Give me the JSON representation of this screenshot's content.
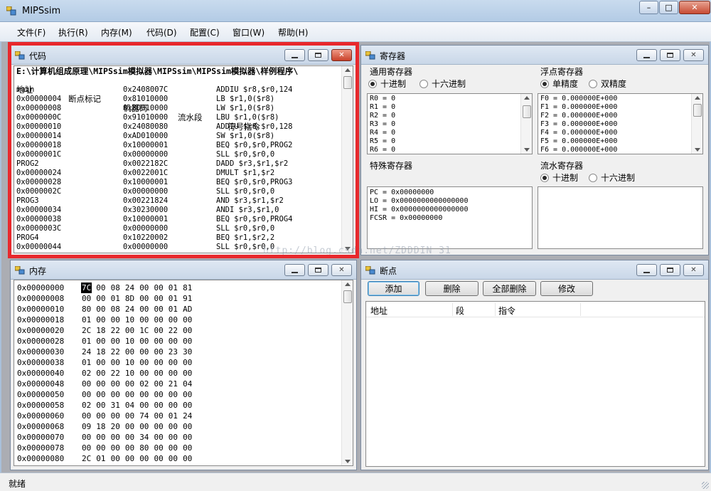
{
  "app": {
    "title": "MIPSsim"
  },
  "window_controls": {
    "minimize_glyph": "–",
    "maximize_glyph": "□",
    "close_glyph": "✕"
  },
  "menu": [
    "文件(F)",
    "执行(R)",
    "内存(M)",
    "代码(D)",
    "配置(C)",
    "窗口(W)",
    "帮助(H)"
  ],
  "code_window": {
    "title": "代码",
    "path": "E:\\计算机组成原理\\MIPSsim模拟器\\MIPSsim\\MIPSsim模拟器\\样例程序\\",
    "columns": [
      "地址",
      "断点标记",
      "机器码",
      "流水段",
      "符号指令"
    ],
    "rows": [
      {
        "addr": "main",
        "code": "0x2408007C",
        "instr": "ADDIU $r8,$r0,124"
      },
      {
        "addr": "0x00000004",
        "code": "0x81010000",
        "instr": "LB $r1,0($r8)"
      },
      {
        "addr": "0x00000008",
        "code": "0x8D010000",
        "instr": "LW $r1,0($r8)"
      },
      {
        "addr": "0x0000000C",
        "code": "0x91010000",
        "instr": "LBU $r1,0($r8)"
      },
      {
        "addr": "0x00000010",
        "code": "0x24080080",
        "instr": "ADDIU $r8,$r0,128"
      },
      {
        "addr": "0x00000014",
        "code": "0xAD010000",
        "instr": "SW $r1,0($r8)"
      },
      {
        "addr": "0x00000018",
        "code": "0x10000001",
        "instr": "BEQ $r0,$r0,PROG2"
      },
      {
        "addr": "0x0000001C",
        "code": "0x00000000",
        "instr": "SLL $r0,$r0,0"
      },
      {
        "addr": "PROG2",
        "code": "0x0022182C",
        "instr": "DADD $r3,$r1,$r2"
      },
      {
        "addr": "0x00000024",
        "code": "0x0022001C",
        "instr": "DMULT $r1,$r2"
      },
      {
        "addr": "0x00000028",
        "code": "0x10000001",
        "instr": "BEQ $r0,$r0,PROG3"
      },
      {
        "addr": "0x0000002C",
        "code": "0x00000000",
        "instr": "SLL $r0,$r0,0"
      },
      {
        "addr": "PROG3",
        "code": "0x00221824",
        "instr": "AND $r3,$r1,$r2"
      },
      {
        "addr": "0x00000034",
        "code": "0x30230000",
        "instr": "ANDI $r3,$r1,0"
      },
      {
        "addr": "0x00000038",
        "code": "0x10000001",
        "instr": "BEQ $r0,$r0,PROG4"
      },
      {
        "addr": "0x0000003C",
        "code": "0x00000000",
        "instr": "SLL $r0,$r0,0"
      },
      {
        "addr": "PROG4",
        "code": "0x10220002",
        "instr": "BEQ $r1,$r2,2"
      },
      {
        "addr": "0x00000044",
        "code": "0x00000000",
        "instr": "SLL $r0,$r0,0"
      }
    ]
  },
  "register_window": {
    "title": "寄存器",
    "general": {
      "label": "通用寄存器",
      "radio_dec": "十进制",
      "radio_hex": "十六进制",
      "selected": "十进制",
      "values": [
        "R0 = 0",
        "R1 = 0",
        "R2 = 0",
        "R3 = 0",
        "R4 = 0",
        "R5 = 0",
        "R6 = 0"
      ]
    },
    "float": {
      "label": "浮点寄存器",
      "radio_single": "单精度",
      "radio_double": "双精度",
      "selected": "单精度",
      "values": [
        "F0 = 0.000000E+000",
        "F1 = 0.000000E+000",
        "F2 = 0.000000E+000",
        "F3 = 0.000000E+000",
        "F4 = 0.000000E+000",
        "F5 = 0.000000E+000",
        "F6 = 0.000000E+000"
      ]
    },
    "special": {
      "label": "特殊寄存器",
      "values": [
        "PC = 0x00000000",
        "LO = 0x0000000000000000",
        "HI = 0x0000000000000000",
        "FCSR = 0x00000000"
      ]
    },
    "pipeline": {
      "label": "流水寄存器",
      "radio_dec": "十进制",
      "radio_hex": "十六进制",
      "selected": "十进制"
    }
  },
  "memory_window": {
    "title": "内存",
    "rows": [
      {
        "addr": "0x00000000",
        "bytes": [
          "7C",
          "00",
          "08",
          "24",
          "00",
          "00",
          "01",
          "81"
        ]
      },
      {
        "addr": "0x00000008",
        "bytes": [
          "00",
          "00",
          "01",
          "8D",
          "00",
          "00",
          "01",
          "91"
        ]
      },
      {
        "addr": "0x00000010",
        "bytes": [
          "80",
          "00",
          "08",
          "24",
          "00",
          "00",
          "01",
          "AD"
        ]
      },
      {
        "addr": "0x00000018",
        "bytes": [
          "01",
          "00",
          "00",
          "10",
          "00",
          "00",
          "00",
          "00"
        ]
      },
      {
        "addr": "0x00000020",
        "bytes": [
          "2C",
          "18",
          "22",
          "00",
          "1C",
          "00",
          "22",
          "00"
        ]
      },
      {
        "addr": "0x00000028",
        "bytes": [
          "01",
          "00",
          "00",
          "10",
          "00",
          "00",
          "00",
          "00"
        ]
      },
      {
        "addr": "0x00000030",
        "bytes": [
          "24",
          "18",
          "22",
          "00",
          "00",
          "00",
          "23",
          "30"
        ]
      },
      {
        "addr": "0x00000038",
        "bytes": [
          "01",
          "00",
          "00",
          "10",
          "00",
          "00",
          "00",
          "00"
        ]
      },
      {
        "addr": "0x00000040",
        "bytes": [
          "02",
          "00",
          "22",
          "10",
          "00",
          "00",
          "00",
          "00"
        ]
      },
      {
        "addr": "0x00000048",
        "bytes": [
          "00",
          "00",
          "00",
          "00",
          "02",
          "00",
          "21",
          "04"
        ]
      },
      {
        "addr": "0x00000050",
        "bytes": [
          "00",
          "00",
          "00",
          "00",
          "00",
          "00",
          "00",
          "00"
        ]
      },
      {
        "addr": "0x00000058",
        "bytes": [
          "02",
          "00",
          "31",
          "04",
          "00",
          "00",
          "00",
          "00"
        ]
      },
      {
        "addr": "0x00000060",
        "bytes": [
          "00",
          "00",
          "00",
          "00",
          "74",
          "00",
          "01",
          "24"
        ]
      },
      {
        "addr": "0x00000068",
        "bytes": [
          "09",
          "18",
          "20",
          "00",
          "00",
          "00",
          "00",
          "00"
        ]
      },
      {
        "addr": "0x00000070",
        "bytes": [
          "00",
          "00",
          "00",
          "00",
          "34",
          "00",
          "00",
          "00"
        ]
      },
      {
        "addr": "0x00000078",
        "bytes": [
          "00",
          "00",
          "00",
          "00",
          "80",
          "00",
          "00",
          "00"
        ]
      },
      {
        "addr": "0x00000080",
        "bytes": [
          "2C",
          "01",
          "00",
          "00",
          "00",
          "00",
          "00",
          "00"
        ]
      }
    ]
  },
  "breakpoint_window": {
    "title": "断点",
    "buttons": [
      "添加",
      "删除",
      "全部删除",
      "修改"
    ],
    "columns": [
      "地址",
      "段",
      "指令"
    ]
  },
  "status": {
    "text": "就绪"
  },
  "watermark": {
    "text": "http://blog.csdn.net/ZDDDIN_31"
  },
  "colors": {
    "highlight_border": "#e8282c",
    "selection": "#000000"
  }
}
